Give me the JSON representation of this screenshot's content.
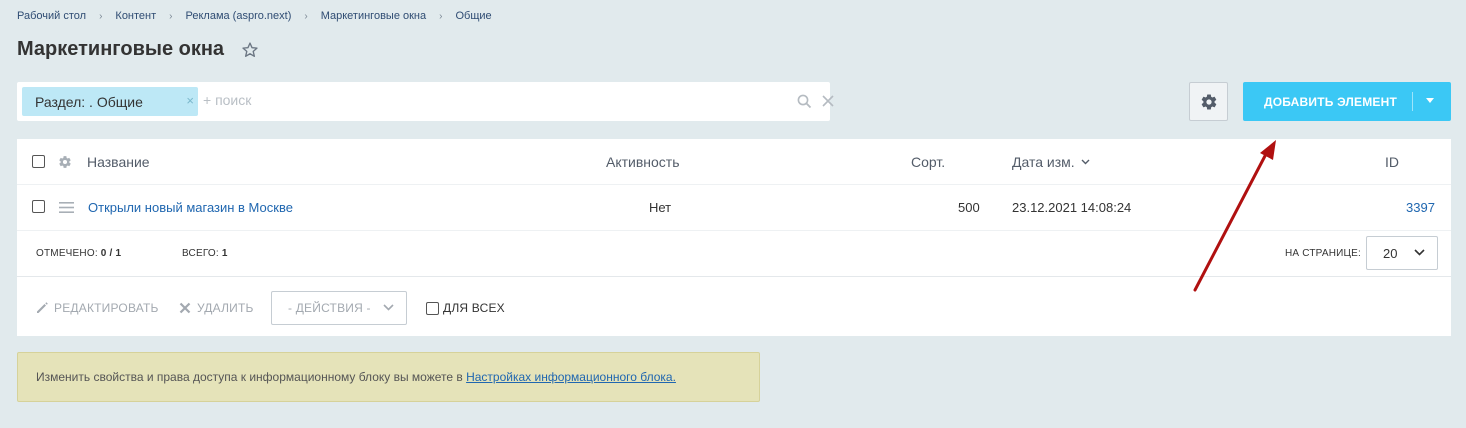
{
  "breadcrumb": [
    "Рабочий стол",
    "Контент",
    "Реклама (aspro.next)",
    "Маркетинговые окна",
    "Общие"
  ],
  "page_title": "Маркетинговые окна",
  "filter": {
    "tag_label": "Раздел: . Общие",
    "tag_close": "×",
    "search_placeholder": "+ поиск"
  },
  "add_button": {
    "label": "ДОБАВИТЬ ЭЛЕМЕНТ"
  },
  "columns": {
    "name": "Название",
    "active": "Активность",
    "sort": "Сорт.",
    "date": "Дата изм.",
    "id": "ID"
  },
  "rows": [
    {
      "name": "Открыли новый магазин в Москве",
      "active": "Нет",
      "sort": "500",
      "date": "23.12.2021 14:08:24",
      "id": "3397"
    }
  ],
  "footer": {
    "selected_label": "ОТМЕЧЕНО:",
    "selected_value": "0 / 1",
    "total_label": "ВСЕГО:",
    "total_value": "1",
    "per_page_label": "НА СТРАНИЦЕ:",
    "per_page_value": "20"
  },
  "actions": {
    "edit": "РЕДАКТИРОВАТЬ",
    "delete": "УДАЛИТЬ",
    "select": "- ДЕЙСТВИЯ -",
    "for_all": "ДЛЯ ВСЕХ"
  },
  "notice": {
    "text": "Изменить свойства и права доступа к информационному блоку вы можете в ",
    "link": "Настройках информационного блока."
  },
  "colors": {
    "background": "#e1eaed",
    "accent_button": "#3bc8f5",
    "filter_tag": "#bde8f6",
    "link": "#2067b0",
    "notice_bg": "#e5e3b9",
    "annotation_arrow": "#b01010"
  }
}
